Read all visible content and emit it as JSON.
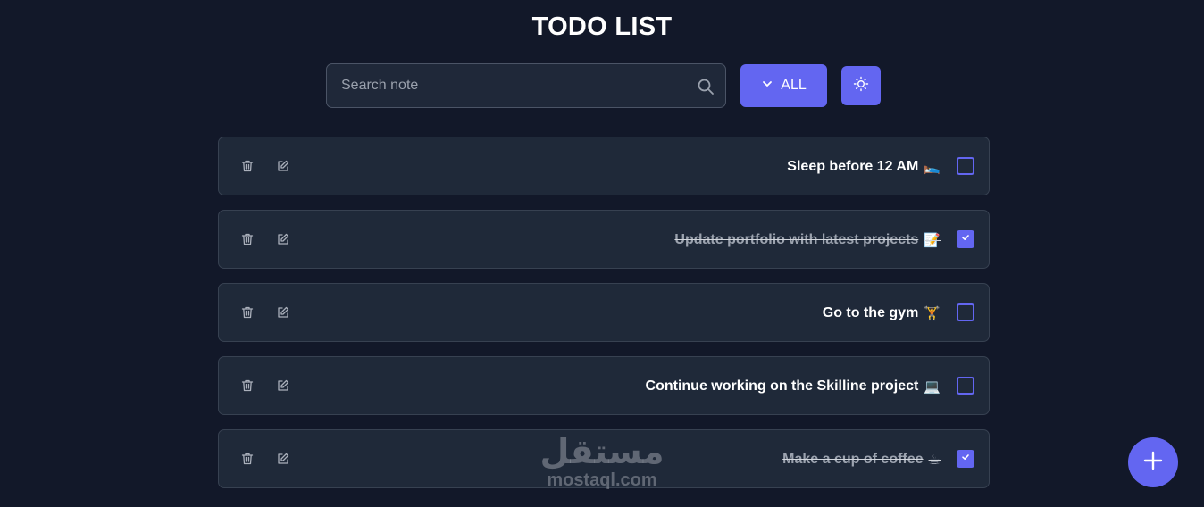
{
  "header": {
    "title": "TODO LIST"
  },
  "search": {
    "placeholder": "Search note",
    "value": ""
  },
  "filter": {
    "label": "ALL"
  },
  "todos": [
    {
      "text": "Sleep before 12 AM",
      "emoji": "🛌",
      "done": false
    },
    {
      "text": "Update portfolio with latest projects",
      "emoji": "📝",
      "done": true
    },
    {
      "text": "Go to the gym",
      "emoji": "🏋",
      "done": false
    },
    {
      "text": "Continue working on the Skilline project",
      "emoji": "💻",
      "done": false
    },
    {
      "text": "Make a cup of coffee",
      "emoji": "☕",
      "done": true
    }
  ],
  "watermark": {
    "arabic": "مستقل",
    "latin": "mostaql.com"
  },
  "icons": {
    "search": "search-icon",
    "chevron": "chevron-down-icon",
    "theme": "sun-icon",
    "delete": "trash-icon",
    "edit": "edit-icon",
    "check": "check-icon",
    "add": "plus-icon"
  },
  "colors": {
    "background": "#121829",
    "card": "#1f2939",
    "accent": "#6366f1"
  }
}
